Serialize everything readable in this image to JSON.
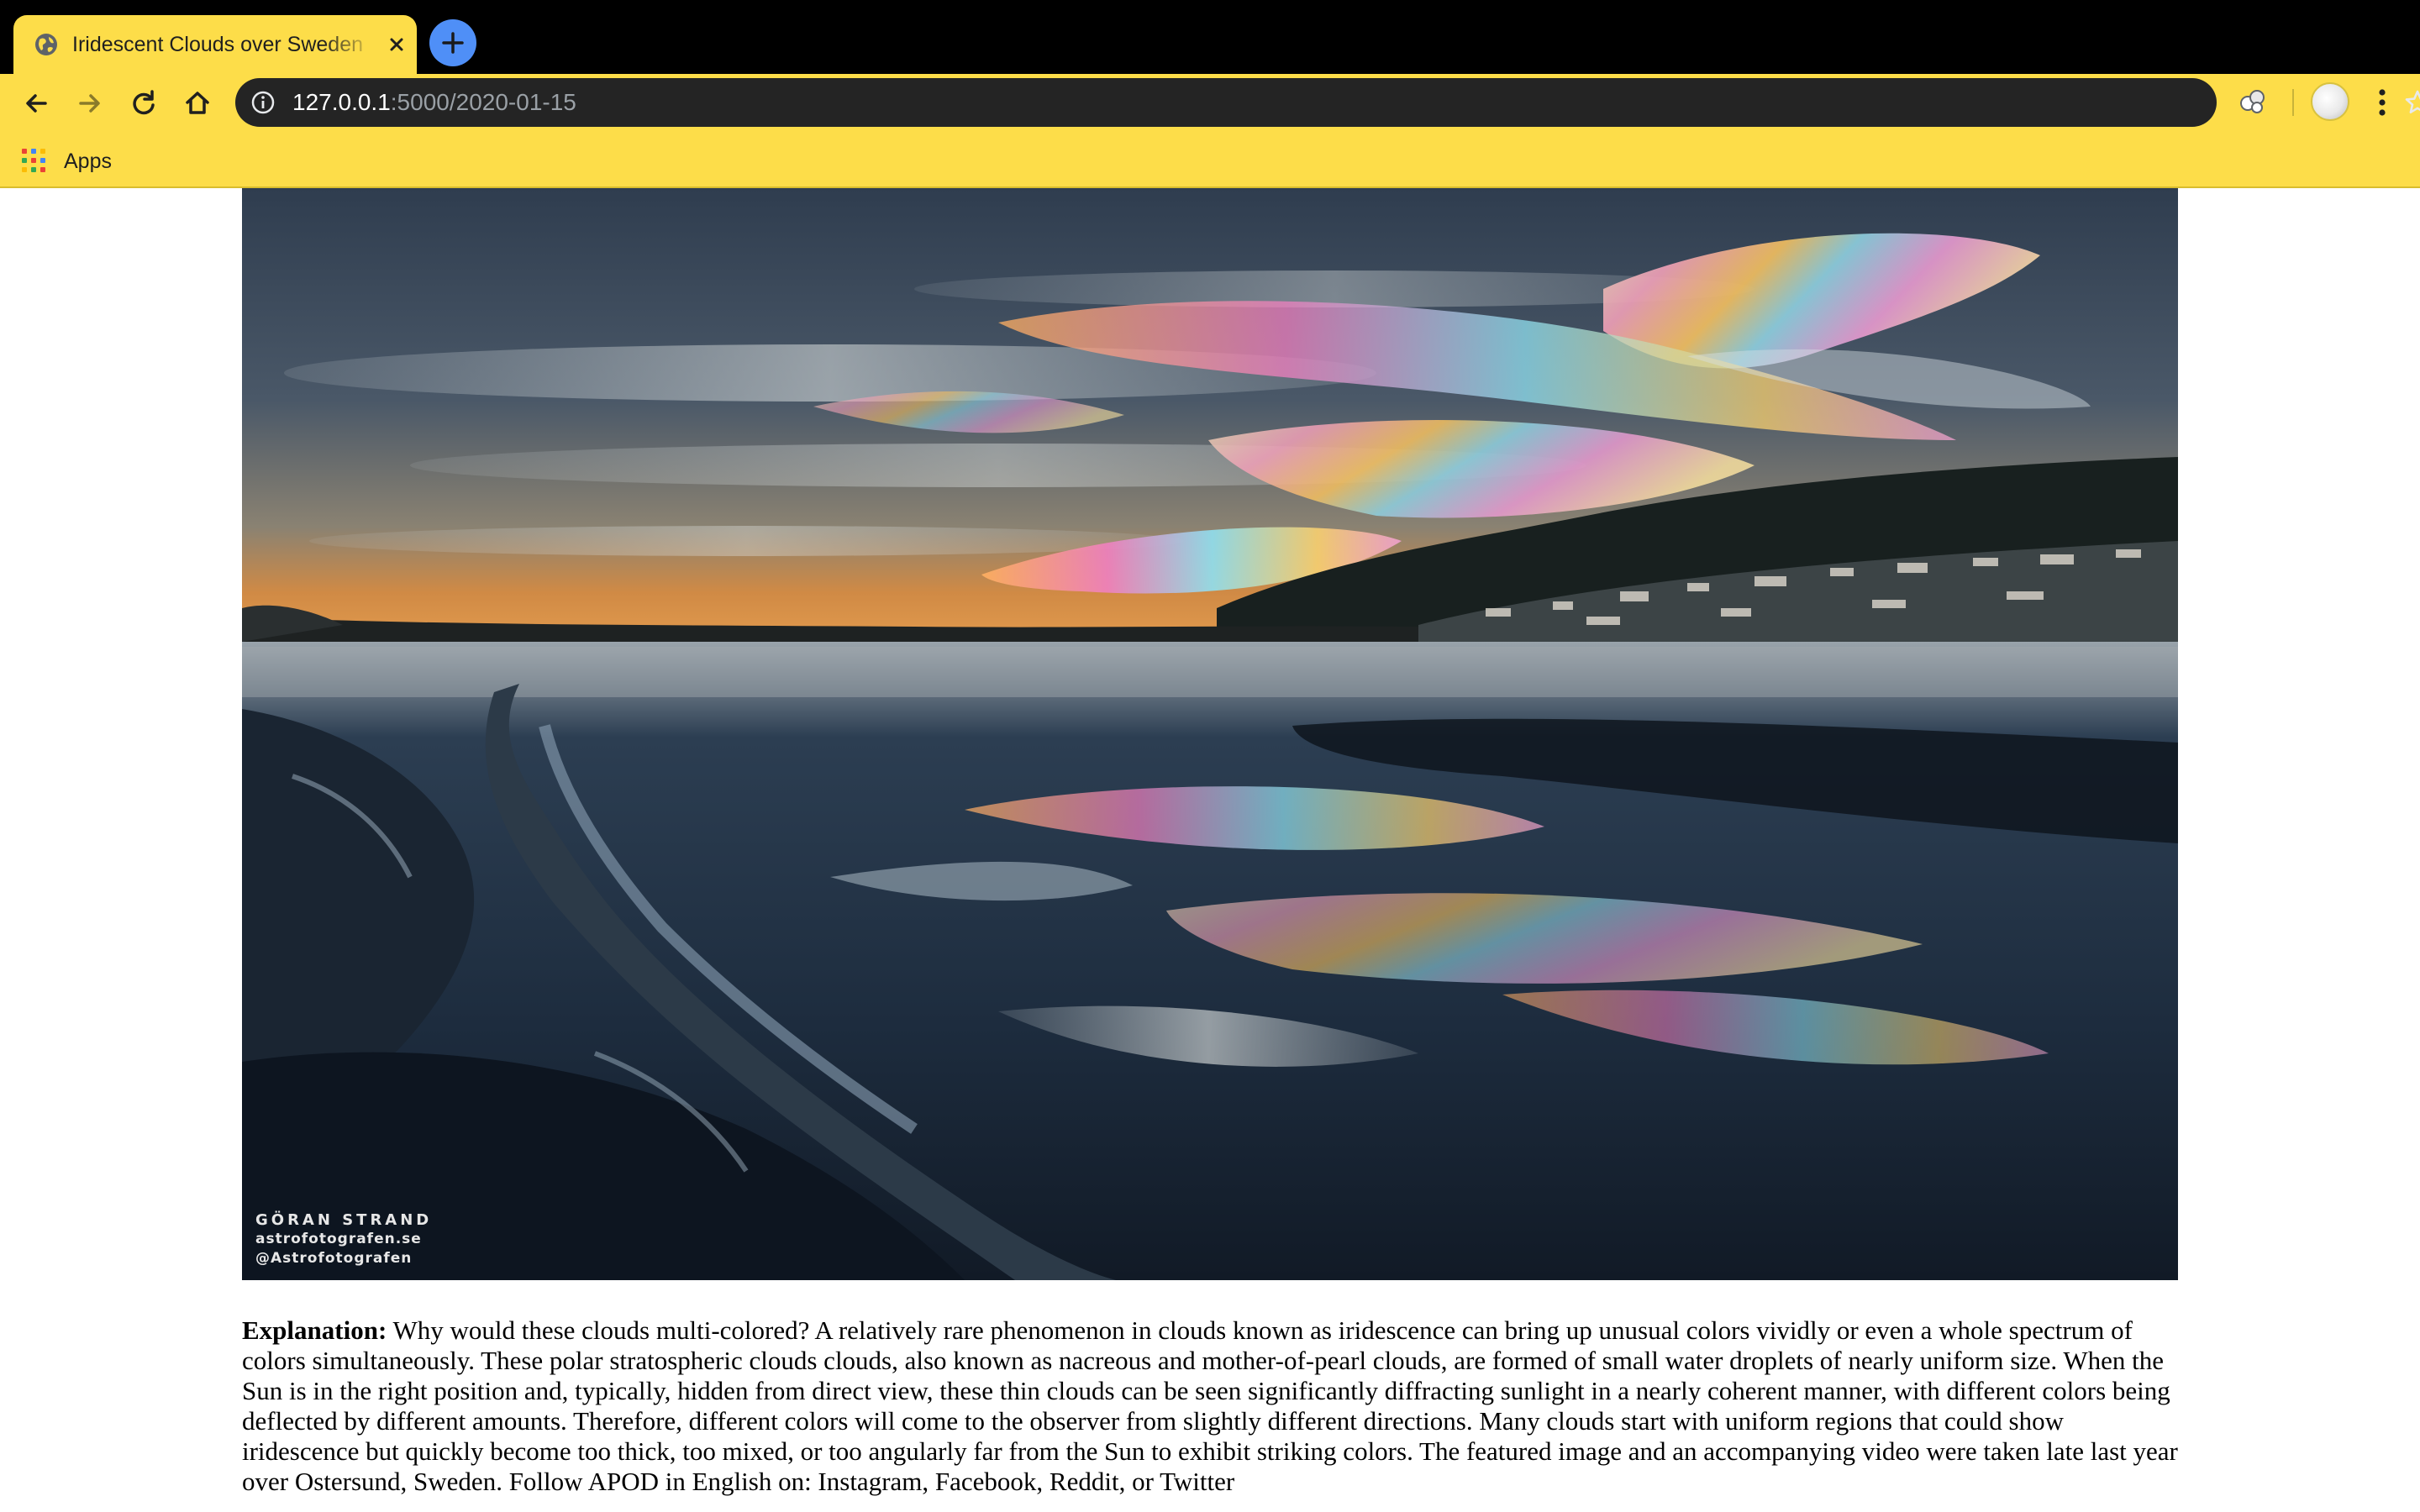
{
  "browser": {
    "tab": {
      "title": "Iridescent Clouds over Sweden",
      "favicon": "globe-icon"
    },
    "new_tab_icon": "plus-icon",
    "toolbar": {
      "back_icon": "arrow-left-icon",
      "forward_icon": "arrow-right-icon",
      "reload_icon": "reload-icon",
      "home_icon": "home-icon",
      "address": {
        "host": "127.0.0.1",
        "rest": ":5000/2020-01-15",
        "info_icon": "info-icon",
        "bookmark_icon": "star-icon"
      },
      "extension_icon": "extension-icon",
      "menu_icon": "kebab-menu-icon"
    },
    "bookmarks_bar": {
      "apps_label": "Apps"
    },
    "theme_color": "#fddd49"
  },
  "page": {
    "image": {
      "description_icon": "photo",
      "credit_line1": "GÖRAN STRAND",
      "credit_line2": "astrofotografen.se",
      "credit_line3": "@Astrofotografen"
    },
    "explanation": {
      "label": "Explanation:",
      "text": " Why would these clouds multi-colored? A relatively rare phenomenon in clouds known as iridescence can bring up unusual colors vividly or even a whole spectrum of colors simultaneously. These polar stratospheric clouds clouds, also known as nacreous and mother-of-pearl clouds, are formed of small water droplets of nearly uniform size. When the Sun is in the right position and, typically, hidden from direct view, these thin clouds can be seen significantly diffracting sunlight in a nearly coherent manner, with different colors being deflected by different amounts. Therefore, different colors will come to the observer from slightly different directions. Many clouds start with uniform regions that could show iridescence but quickly become too thick, too mixed, or too angularly far from the Sun to exhibit striking colors. The featured image and an accompanying video were taken late last year over Ostersund, Sweden. Follow APOD in English on: Instagram, Facebook, Reddit, or Twitter"
    }
  }
}
